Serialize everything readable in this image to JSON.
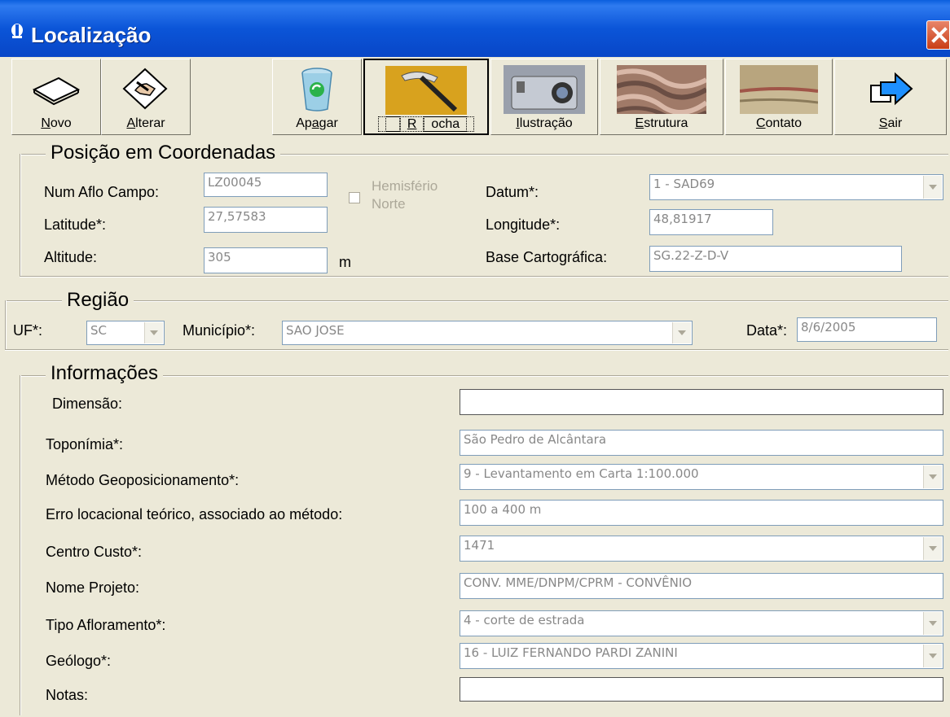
{
  "window": {
    "title": "Localização",
    "close_icon": "close-icon",
    "app_icon": "app-icon"
  },
  "toolbar": {
    "buttons": [
      {
        "label_pre": "",
        "label_ul": "N",
        "label_post": "ovo",
        "icon": "paper-stack-icon"
      },
      {
        "label_pre": "",
        "label_ul": "A",
        "label_post": "lterar",
        "icon": "edit-hand-icon"
      },
      {
        "label_pre": "Ap",
        "label_ul": "a",
        "label_post": "gar",
        "icon": "recycle-bin-icon"
      },
      {
        "label_pre": "",
        "label_ul": "R",
        "label_post": "ocha",
        "icon": "rock-hammer-icon"
      },
      {
        "label_pre": "",
        "label_ul": "I",
        "label_post": "lustração",
        "icon": "camera-icon"
      },
      {
        "label_pre": "",
        "label_ul": "E",
        "label_post": "strutura",
        "icon": "structure-image-icon"
      },
      {
        "label_pre": "",
        "label_ul": "C",
        "label_post": "ontato",
        "icon": "contact-image-icon"
      },
      {
        "label_pre": "",
        "label_ul": "S",
        "label_post": "air",
        "icon": "exit-arrow-icon"
      }
    ]
  },
  "posicao": {
    "title": "Posição em Coordenadas",
    "num_aflo_label": "Num Aflo Campo:",
    "num_aflo_value": "LZ00045",
    "hemisferio_label_1": "Hemisfério",
    "hemisferio_label_2": "Norte",
    "datum_label": "Datum*:",
    "datum_value": "1 - SAD69",
    "latitude_label": "Latitude*:",
    "latitude_value": "27,57583",
    "longitude_label": "Longitude*:",
    "longitude_value": "48,81917",
    "altitude_label": "Altitude:",
    "altitude_value": "305",
    "altitude_unit": "m",
    "base_label": "Base Cartográfica:",
    "base_value": "SG.22-Z-D-V"
  },
  "regiao": {
    "title": "Região",
    "uf_label": "UF*:",
    "uf_value": "SC",
    "municipio_label": "Município*:",
    "municipio_value": "SAO JOSE",
    "data_label": "Data*:",
    "data_value": "8/6/2005"
  },
  "informacoes": {
    "title": "Informações",
    "rows": [
      {
        "label": "Dimensão:",
        "value": ""
      },
      {
        "label": "Toponímia*:",
        "value": "São Pedro de Alcântara"
      },
      {
        "label": "Método Geoposicionamento*:",
        "value": "9 - Levantamento em Carta 1:100.000"
      },
      {
        "label": "Erro locacional teórico, associado ao método:",
        "value": "100 a 400 m"
      },
      {
        "label": "Centro Custo*:",
        "value": "1471"
      },
      {
        "label": "Nome  Projeto:",
        "value": "CONV. MME/DNPM/CPRM - CONVÊNIO"
      },
      {
        "label": "Tipo Afloramento*:",
        "value": "4 - corte de estrada"
      },
      {
        "label": "Geólogo*:",
        "value": "16 - LUIZ FERNANDO PARDI ZANINI"
      },
      {
        "label": "Notas:",
        "value": ""
      }
    ]
  }
}
